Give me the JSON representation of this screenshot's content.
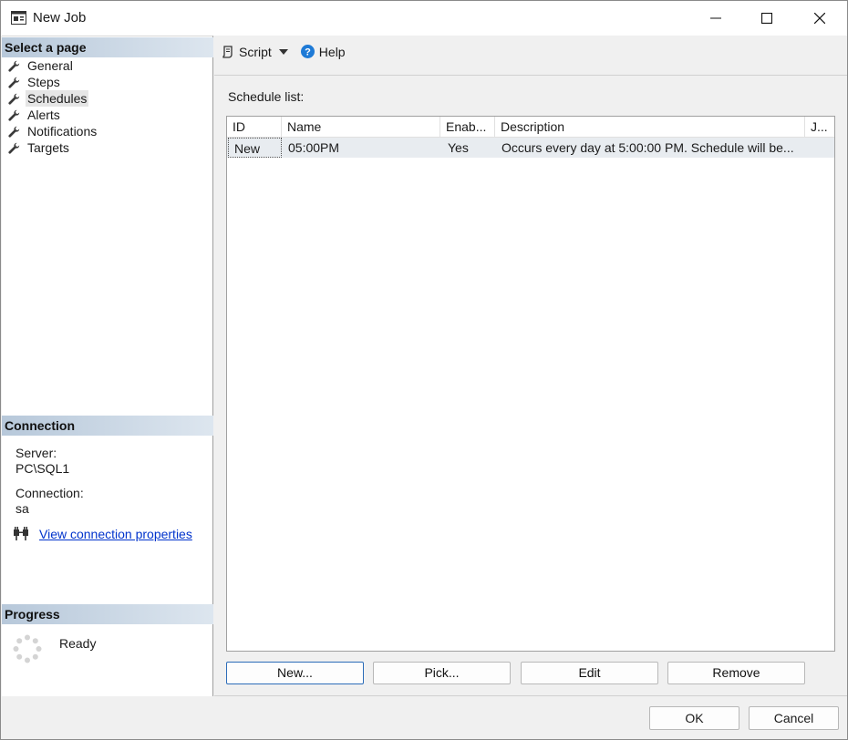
{
  "window": {
    "title": "New Job"
  },
  "left": {
    "select_header": "Select a page",
    "pages": [
      {
        "label": "General"
      },
      {
        "label": "Steps"
      },
      {
        "label": "Schedules"
      },
      {
        "label": "Alerts"
      },
      {
        "label": "Notifications"
      },
      {
        "label": "Targets"
      }
    ],
    "selected_page": "Schedules",
    "connection_header": "Connection",
    "server_label": "Server:",
    "server_value": "PC\\SQL1",
    "connection_label": "Connection:",
    "connection_value": "sa",
    "view_link": "View connection properties",
    "progress_header": "Progress",
    "progress_status": "Ready"
  },
  "toolbar": {
    "script_label": "Script",
    "help_label": "Help"
  },
  "content": {
    "schedule_list_label": "Schedule list:",
    "columns": [
      "ID",
      "Name",
      "Enab...",
      "Description",
      "J..."
    ],
    "rows": [
      {
        "id": "New",
        "name": "05:00PM",
        "enabled": "Yes",
        "description": "Occurs every day at 5:00:00 PM. Schedule will be...",
        "j": ""
      }
    ],
    "buttons": {
      "new": "New...",
      "pick": "Pick...",
      "edit": "Edit",
      "remove": "Remove"
    }
  },
  "footer": {
    "ok": "OK",
    "cancel": "Cancel"
  },
  "colors": {
    "header_gradient_start": "#b7c8da",
    "header_gradient_end": "#dde6ef",
    "link": "#0033cc",
    "selected_row": "#e8ecf0",
    "help_icon": "#1e7ad6"
  }
}
